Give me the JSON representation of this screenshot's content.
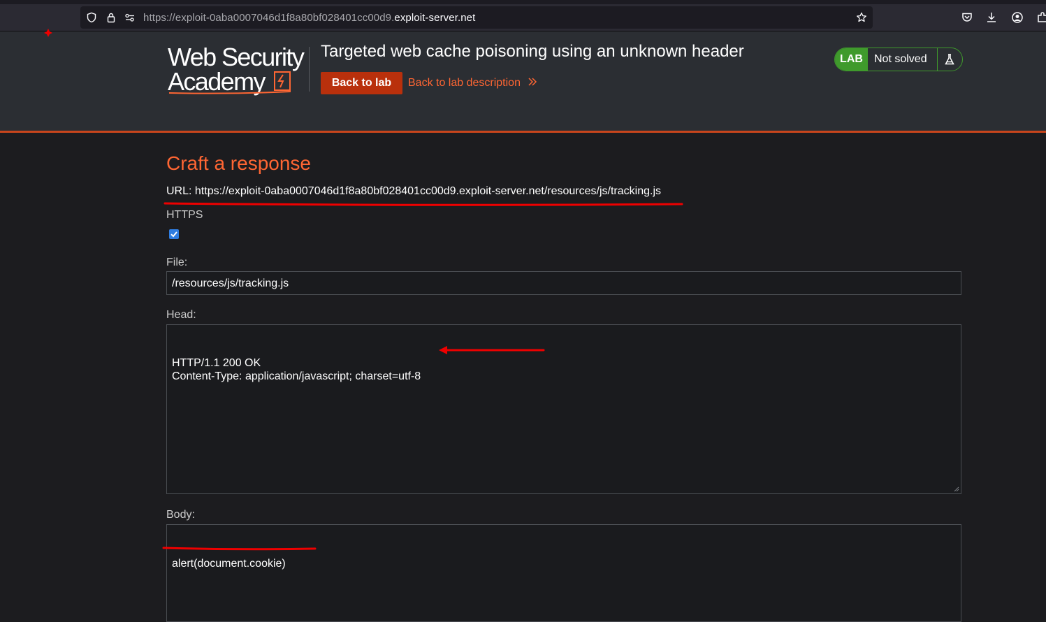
{
  "browser": {
    "url_prefix": "https://exploit-0aba0007046d1f8a80bf028401cc00d9.",
    "url_host": "exploit-server.net"
  },
  "lab_header": {
    "logo_line1": "Web Security",
    "logo_line2": "Academy",
    "title": "Targeted web cache poisoning using an unknown header",
    "back_to_lab": "Back to lab",
    "back_to_description": "Back to lab description",
    "status_tag": "LAB",
    "status_text": "Not solved"
  },
  "form": {
    "heading": "Craft a response",
    "url_line": "URL: https://exploit-0aba0007046d1f8a80bf028401cc00d9.exploit-server.net/resources/js/tracking.js",
    "https_label": "HTTPS",
    "https_checked": true,
    "file_label": "File:",
    "file_value": "/resources/js/tracking.js",
    "head_label": "Head:",
    "head_value": "HTTP/1.1 200 OK\nContent-Type: application/javascript; charset=utf-8",
    "body_label": "Body:",
    "body_value": "alert(document.cookie)"
  },
  "colors": {
    "accent": "#ff6633",
    "button": "#b9300c",
    "status_green": "#3f9a2c",
    "annotation_red": "#ee0000"
  }
}
